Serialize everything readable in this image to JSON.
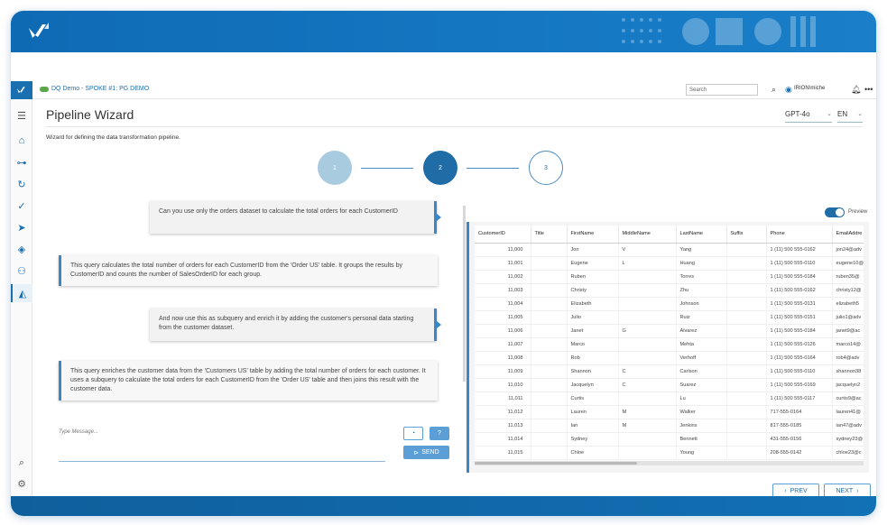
{
  "header": {
    "breadcrumb": "DQ Demo - SPOKE #1: PG DEMO",
    "search_placeholder": "Search",
    "user": "IRION\\miche"
  },
  "page": {
    "title": "Pipeline Wizard",
    "subtitle": "Wizard for defining the data transformation pipeline.",
    "model": "GPT-4o",
    "language": "EN"
  },
  "steps": [
    "1",
    "2",
    "3"
  ],
  "chat": {
    "messages": [
      {
        "role": "user",
        "text": "Can you use only the orders dataset to calculate the total orders for each CustomerID"
      },
      {
        "role": "ai",
        "text": "This query calculates the total number of orders for each CustomerID from the 'Order US' table. It groups the results by CustomerID and counts the number of SalesOrderID for each group."
      },
      {
        "role": "user",
        "text": "And now use this as subquery and enrich it by adding the customer's personal data starting from the customer dataset."
      },
      {
        "role": "ai",
        "text": "This query enriches the customer data from the 'Customers US' table by adding the total number of orders for each customer. It uses a subquery to calculate the total orders for each CustomerID from the 'Order US' table and then joins this result with the customer data."
      }
    ],
    "input_placeholder": "Type Message...",
    "help_label": "?",
    "send_label": "SEND"
  },
  "preview": {
    "label": "Preview",
    "columns": [
      "CustomerID",
      "Title",
      "FirstName",
      "MiddleName",
      "LastName",
      "Suffix",
      "Phone",
      "EmailAddre"
    ],
    "rows": [
      [
        "11,000",
        "",
        "Jon",
        "V",
        "Yang",
        "",
        "1 (11) 500 555-0162",
        "jon24@adv"
      ],
      [
        "11,001",
        "",
        "Eugene",
        "L",
        "Huang",
        "",
        "1 (11) 500 555-0110",
        "eugene10@"
      ],
      [
        "11,002",
        "",
        "Ruben",
        "",
        "Torres",
        "",
        "1 (11) 500 555-0184",
        "ruben35@"
      ],
      [
        "11,003",
        "",
        "Christy",
        "",
        "Zhu",
        "",
        "1 (11) 500 555-0162",
        "christy12@"
      ],
      [
        "11,004",
        "",
        "Elizabeth",
        "",
        "Johnson",
        "",
        "1 (11) 500 555-0131",
        "elizabeth5"
      ],
      [
        "11,005",
        "",
        "Julio",
        "",
        "Ruiz",
        "",
        "1 (11) 500 555-0151",
        "julio1@adv"
      ],
      [
        "11,006",
        "",
        "Janet",
        "G",
        "Alvarez",
        "",
        "1 (11) 500 555-0184",
        "janet9@ac"
      ],
      [
        "11,007",
        "",
        "Marco",
        "",
        "Mehta",
        "",
        "1 (11) 500 555-0126",
        "marco14@"
      ],
      [
        "11,008",
        "",
        "Rob",
        "",
        "Verhoff",
        "",
        "1 (11) 500 555-0164",
        "rob4@adv"
      ],
      [
        "11,009",
        "",
        "Shannon",
        "C",
        "Carlson",
        "",
        "1 (11) 500 555-0110",
        "shannon38"
      ],
      [
        "11,010",
        "",
        "Jacquelyn",
        "C",
        "Suarez",
        "",
        "1 (11) 500 555-0169",
        "jacquelyn2"
      ],
      [
        "11,011",
        "",
        "Curtis",
        "",
        "Lu",
        "",
        "1 (11) 500 555-0117",
        "curtis9@ac"
      ],
      [
        "11,012",
        "",
        "Lauren",
        "M",
        "Walker",
        "",
        "717-555-0164",
        "lauren41@"
      ],
      [
        "11,013",
        "",
        "Ian",
        "M",
        "Jenkins",
        "",
        "817-555-0185",
        "ian47@adv"
      ],
      [
        "11,014",
        "",
        "Sydney",
        "",
        "Bennett",
        "",
        "431-555-0156",
        "sydney23@"
      ],
      [
        "11,015",
        "",
        "Chloe",
        "",
        "Young",
        "",
        "208-555-0142",
        "chloe23@c"
      ]
    ]
  },
  "nav": {
    "prev_label": "PREV",
    "next_label": "NEXT"
  },
  "colors": {
    "brand": "#1a6fb0",
    "accent": "#3d86c6",
    "step_done": "#a9cbdf",
    "step_active": "#1f6ca6"
  },
  "icons": [
    "menu-icon",
    "home-icon",
    "connection-icon",
    "refresh-icon",
    "check-icon",
    "send-icon",
    "layers-icon",
    "users-icon",
    "pipeline-icon",
    "search-icon",
    "settings-icon",
    "user-icon",
    "bell-icon",
    "more-icon",
    "reset-icon"
  ]
}
